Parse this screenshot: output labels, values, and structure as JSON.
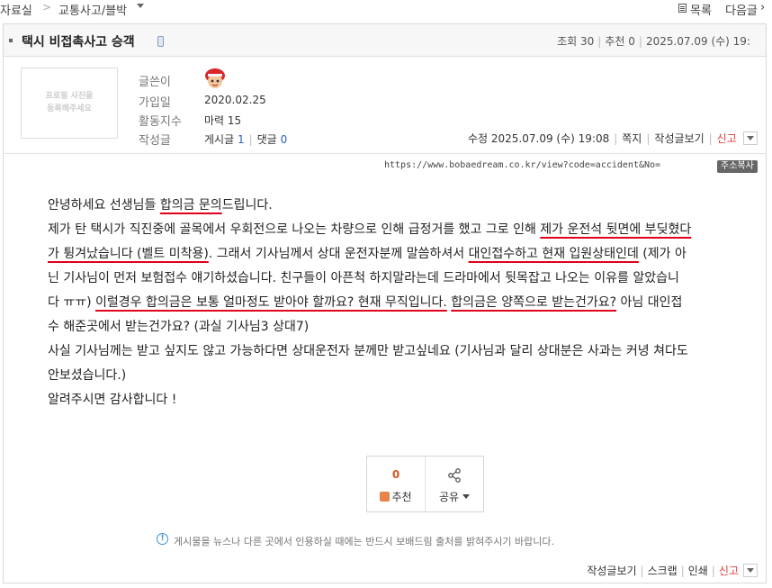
{
  "breadcrumb": {
    "root": "자료실",
    "separator": ">",
    "board": "교통사고/블박"
  },
  "nav": {
    "list_label": "목록",
    "next_label": "다음글",
    "next_arrow": "›"
  },
  "post": {
    "title": "택시 비접촉사고 승객",
    "views_label": "조회",
    "views": "30",
    "recommend_label": "추천",
    "recommend": "0",
    "date": "2025.07.09 (수) 19:"
  },
  "profile": {
    "photo_text_1": "프로필 사진을",
    "photo_text_2": "등록해주세요",
    "author_label": "글쓴이",
    "joined_label": "가입일",
    "joined": "2020.02.25",
    "activity_label": "활동지수",
    "activity": "마력 15",
    "posts_label": "작성글",
    "posts_text": "게시글",
    "posts_count": "1",
    "comments_text": "댓글",
    "comments_count": "0"
  },
  "meta": {
    "edited": "수정 2025.07.09 (수) 19:08",
    "message": "쪽지",
    "view_posts": "작성글보기",
    "report": "신고"
  },
  "url_bar": {
    "url": "https://www.bobaedream.co.kr/view?code=accident&No=",
    "copy_label": "주소복사"
  },
  "content": {
    "l1a": "안녕하세요 선생님들 ",
    "l1u": "합의금 문의",
    "l1b": "드립니다.",
    "l2a": "제가 탄 택시가 직진중에 골목에서 우회전으로 나오는 차량으로 인해 급정거를 했고 그로 인해 ",
    "l2u": "제가 운전석 뒷면에 부딪혔다",
    "l3u": "가 튕겨났습니다 (벨트 미착용)",
    "l3a": ". 그래서 기사님께서 상대 운전자분께 말씀하셔서 ",
    "l3u2": "대인접수하고 현재 입원상태인데",
    "l3b": " (제가 아",
    "l4": "닌 기사님이 먼저 보험접수 얘기하셨습니다. 친구들이 아픈척 하지말라는데 드라마에서 뒷목잡고 나오는 이유를 알았습니",
    "l5a": "다 ㅠㅠ) ",
    "l5u": "이럴경우 합의금은 보통 얼마정도 받아야 할까요? 현재 무직입니다.",
    "l5b": " ",
    "l5u2": "합의금은 양쪽으로 받는건가요?",
    "l5c": " 아님 대인접",
    "l6": "수 해준곳에서 받는건가요? (과실 기사님3 상대7)",
    "l7": "사실 기사님께는 받고 싶지도 않고 가능하다면 상대운전자 분께만 받고싶네요 (기사님과 달리 상대분은 사과는 커녕 쳐다도",
    "l8": "안보셨습니다.)",
    "l9": "알려주시면 감사합니다 !"
  },
  "actions": {
    "recommend_count": "0",
    "recommend_label": "추천",
    "share_label": "공유"
  },
  "notice": "게시물을 뉴스나 다른 곳에서 인용하실 때에는 반드시 보배드림 출처를 밝혀주시기 바랍니다.",
  "footer": {
    "view_posts": "작성글보기",
    "scrap": "스크랩",
    "print": "인쇄",
    "report": "신고"
  },
  "colors": {
    "accent_red": "#e0001b",
    "link_blue": "#2a62c9",
    "report_red": "#e03b3b"
  }
}
